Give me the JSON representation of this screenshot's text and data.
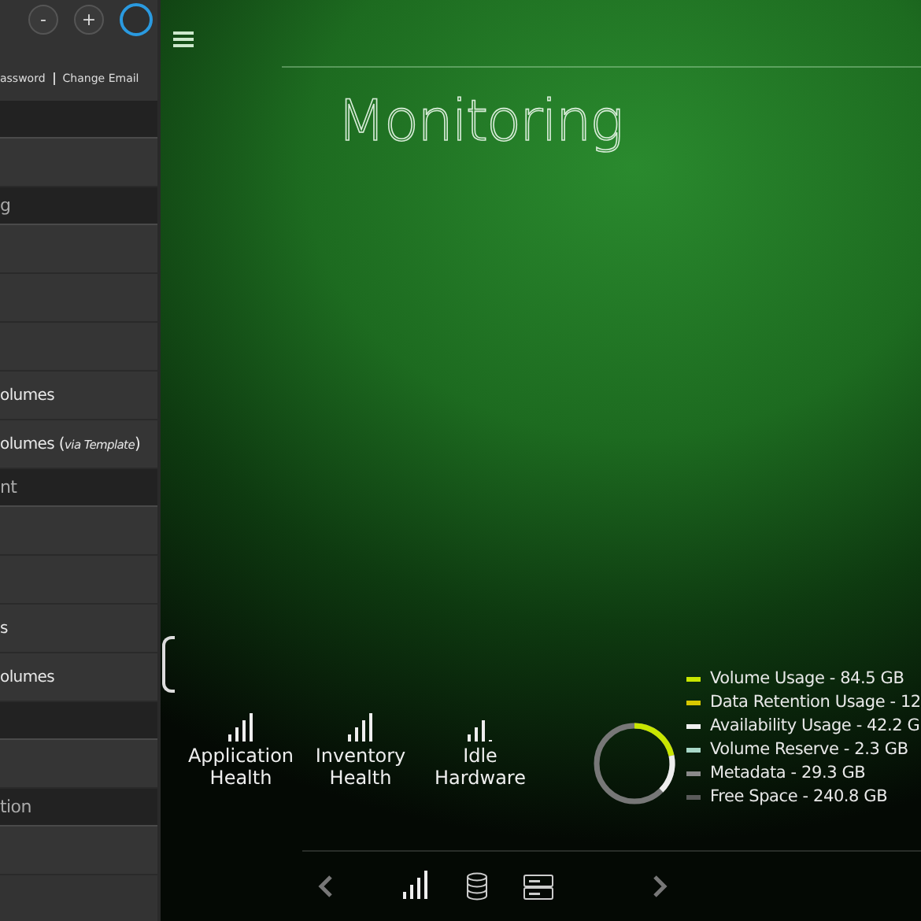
{
  "sidebar": {
    "top_buttons": [
      "-",
      "+"
    ],
    "account_links": [
      "assword",
      "Change Email"
    ],
    "items": [
      {
        "kind": "header"
      },
      {
        "kind": "item"
      },
      {
        "kind": "header",
        "text": "g"
      },
      {
        "kind": "item"
      },
      {
        "kind": "item"
      },
      {
        "kind": "item"
      },
      {
        "kind": "item",
        "text": "olumes"
      },
      {
        "kind": "item",
        "text": "olumes (*via Template*)"
      },
      {
        "kind": "header",
        "text": "nt"
      },
      {
        "kind": "item"
      },
      {
        "kind": "item"
      },
      {
        "kind": "item",
        "text": "s"
      },
      {
        "kind": "item",
        "text": "olumes"
      },
      {
        "kind": "header"
      },
      {
        "kind": "item"
      },
      {
        "kind": "header",
        "text": "tion"
      },
      {
        "kind": "item"
      }
    ]
  },
  "main": {
    "title": "Monitoring",
    "health": [
      {
        "label": "Application Health"
      },
      {
        "label": "Inventory Health"
      },
      {
        "label": "Idle Hardware"
      }
    ],
    "legend": [
      {
        "label": "Volume Usage - 84.5 GB",
        "color": "#c8e600"
      },
      {
        "label": "Data Retention Usage - 12",
        "color": "#d8c800"
      },
      {
        "label": "Availability Usage - 42.2 G",
        "color": "#f0f0f0"
      },
      {
        "label": "Volume Reserve - 2.3 GB",
        "color": "#a8d8c8"
      },
      {
        "label": "Metadata - 29.3 GB",
        "color": "#8a8a8a"
      },
      {
        "label": "Free Space - 240.8 GB",
        "color": "#5a5a5a"
      }
    ]
  }
}
